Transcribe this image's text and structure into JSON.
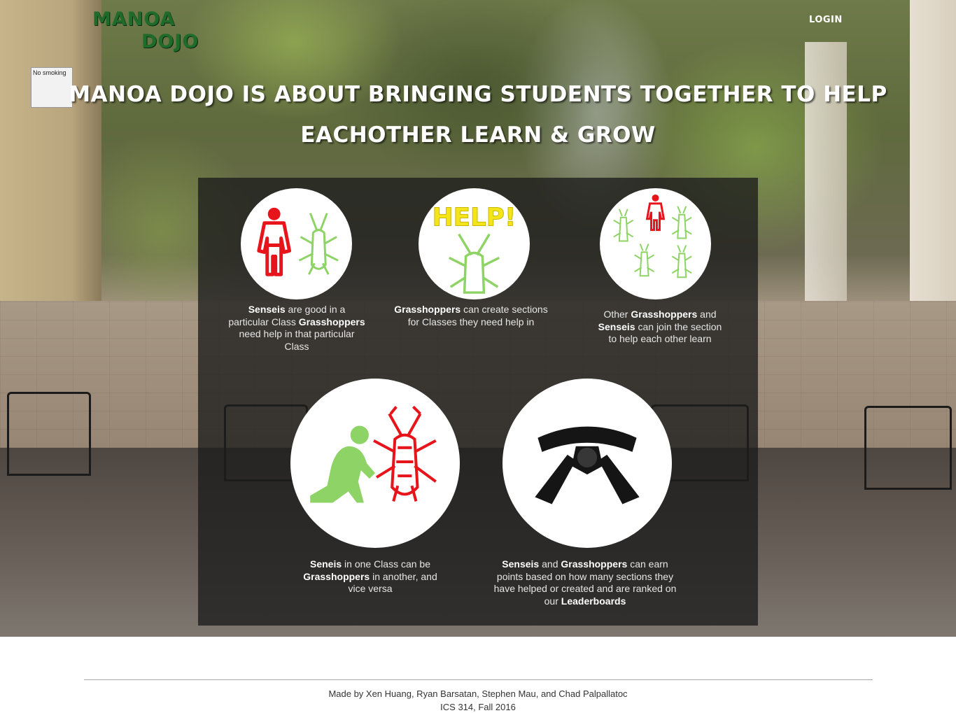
{
  "nav": {
    "logo_line1": "MANOA",
    "logo_line2": "DOJO",
    "login": "LOGIN"
  },
  "background_sign": "No smoking",
  "headline": "Manoa Dojo is about bringing students together to help eachother learn & grow",
  "features": [
    {
      "icon": "sensei-and-grasshopper-icon",
      "parts": [
        {
          "t": "Senseis",
          "b": true
        },
        {
          "t": " are good in a particular Class ",
          "b": false
        },
        {
          "t": "Grasshoppers",
          "b": true
        },
        {
          "t": " need help in that particular Class",
          "b": false
        }
      ]
    },
    {
      "icon": "help-grasshopper-icon",
      "icon_text": "HELP!",
      "parts": [
        {
          "t": "Grasshoppers",
          "b": true
        },
        {
          "t": " can create sections for Classes they need help in",
          "b": false
        }
      ]
    },
    {
      "icon": "group-section-icon",
      "parts": [
        {
          "t": "Other ",
          "b": false
        },
        {
          "t": "Grasshoppers",
          "b": true
        },
        {
          "t": " and ",
          "b": false
        },
        {
          "t": "Senseis",
          "b": true
        },
        {
          "t": " can join the section to help each other learn",
          "b": false
        }
      ]
    },
    {
      "icon": "bowing-student-icon",
      "parts": [
        {
          "t": "Seneis",
          "b": true
        },
        {
          "t": " in one Class can be ",
          "b": false
        },
        {
          "t": "Grasshoppers",
          "b": true
        },
        {
          "t": " in another, and vice versa",
          "b": false
        }
      ]
    },
    {
      "icon": "black-belt-icon",
      "parts": [
        {
          "t": "Senseis",
          "b": true
        },
        {
          "t": " and ",
          "b": false
        },
        {
          "t": "Grasshoppers",
          "b": true
        },
        {
          "t": " can earn points based on how many sections they have helped or created and are ranked on our ",
          "b": false
        },
        {
          "t": "Leaderboards",
          "b": true
        }
      ]
    }
  ],
  "footer": {
    "credits": "Made by Xen Huang, Ryan Barsatan, Stephen Mau, and Chad Palpallatoc",
    "course": "ICS 314, Fall 2016"
  },
  "colors": {
    "logo_green": "#1e6b2a",
    "sensei_red": "#e8141b",
    "grasshopper_green": "#8ed365",
    "help_yellow": "#f4e51a"
  }
}
